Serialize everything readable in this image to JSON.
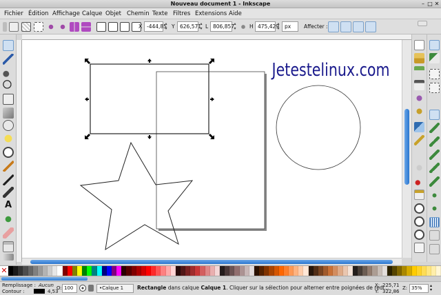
{
  "window": {
    "title": "Nouveau document 1 - Inkscape",
    "controls": [
      "–",
      "□",
      "✕"
    ]
  },
  "menu": [
    "Fichier",
    "Édition",
    "Affichage",
    "Calque",
    "Objet",
    "Chemin",
    "Texte",
    "Filtres",
    "Extensions",
    "Aide"
  ],
  "toolbar": {
    "x_label": "X",
    "x_value": "-444,85",
    "y_label": "Y",
    "y_value": "626,571",
    "w_label": "L",
    "w_value": "806,857",
    "h_label": "H",
    "h_value": "475,429",
    "unit": "px",
    "affect_label": "Affecter :"
  },
  "canvas": {
    "watermark_text": "Jetestelinux.com",
    "watermark_color": "#1a1a8c"
  },
  "palette": {
    "colors": [
      "#000000",
      "#1a1a1a",
      "#333333",
      "#4d4d4d",
      "#666666",
      "#808080",
      "#999999",
      "#b3b3b3",
      "#cccccc",
      "#e6e6e6",
      "#ffffff",
      "#800000",
      "#ff0000",
      "#808000",
      "#ffff00",
      "#008000",
      "#00ff00",
      "#008080",
      "#00ffff",
      "#000080",
      "#0000ff",
      "#800080",
      "#ff00ff",
      "#2b0000",
      "#550000",
      "#800000",
      "#aa0000",
      "#d40000",
      "#ff0000",
      "#ff2a2a",
      "#ff5555",
      "#ff8080",
      "#ffaaaa",
      "#ffd5d5",
      "#280b0b",
      "#501616",
      "#782121",
      "#a02c2c",
      "#c83737",
      "#d35f5f",
      "#de8787",
      "#e9afaf",
      "#f4d7d7",
      "#241c1c",
      "#483737",
      "#6c5353",
      "#916f6f",
      "#ac9393",
      "#c8b7b7",
      "#e3dbdb",
      "#2b1100",
      "#552200",
      "#803300",
      "#aa4400",
      "#d45500",
      "#ff6600",
      "#ff7f2a",
      "#ff9955",
      "#ffb380",
      "#ffccaa",
      "#ffe6d5",
      "#28170b",
      "#502d16",
      "#784421",
      "#a05a2c",
      "#c87137",
      "#d38d5f",
      "#deaa87",
      "#e9c6af",
      "#f4e3d7",
      "#241f1c",
      "#483e37",
      "#6c5d53",
      "#917c6f",
      "#ac9d93",
      "#c8beb7",
      "#e3dedb",
      "#2b2200",
      "#554400",
      "#806600",
      "#aa8800",
      "#d4aa00",
      "#ffcc00",
      "#ffd42a",
      "#ffdd55",
      "#ffe680",
      "#ffeeaa",
      "#fff6d5"
    ]
  },
  "status": {
    "fill_label": "Remplissage :",
    "fill_value": "Aucun",
    "stroke_label": "Contour :",
    "stroke_width": "4,53",
    "opacity_label": "O:",
    "opacity_value": "100",
    "layer": "•Calque 1",
    "message_bold": "Rectangle",
    "message_mid": " dans calque ",
    "message_layer": "Calque 1",
    "message_rest": ". Cliquer sur la sélection pour alterner entre poignées de redi...",
    "x_label": "X:",
    "x_value": "225,71",
    "y_label": "Y:",
    "y_value": "322,86",
    "zoom_label": "Z:",
    "zoom_value": "35%"
  }
}
